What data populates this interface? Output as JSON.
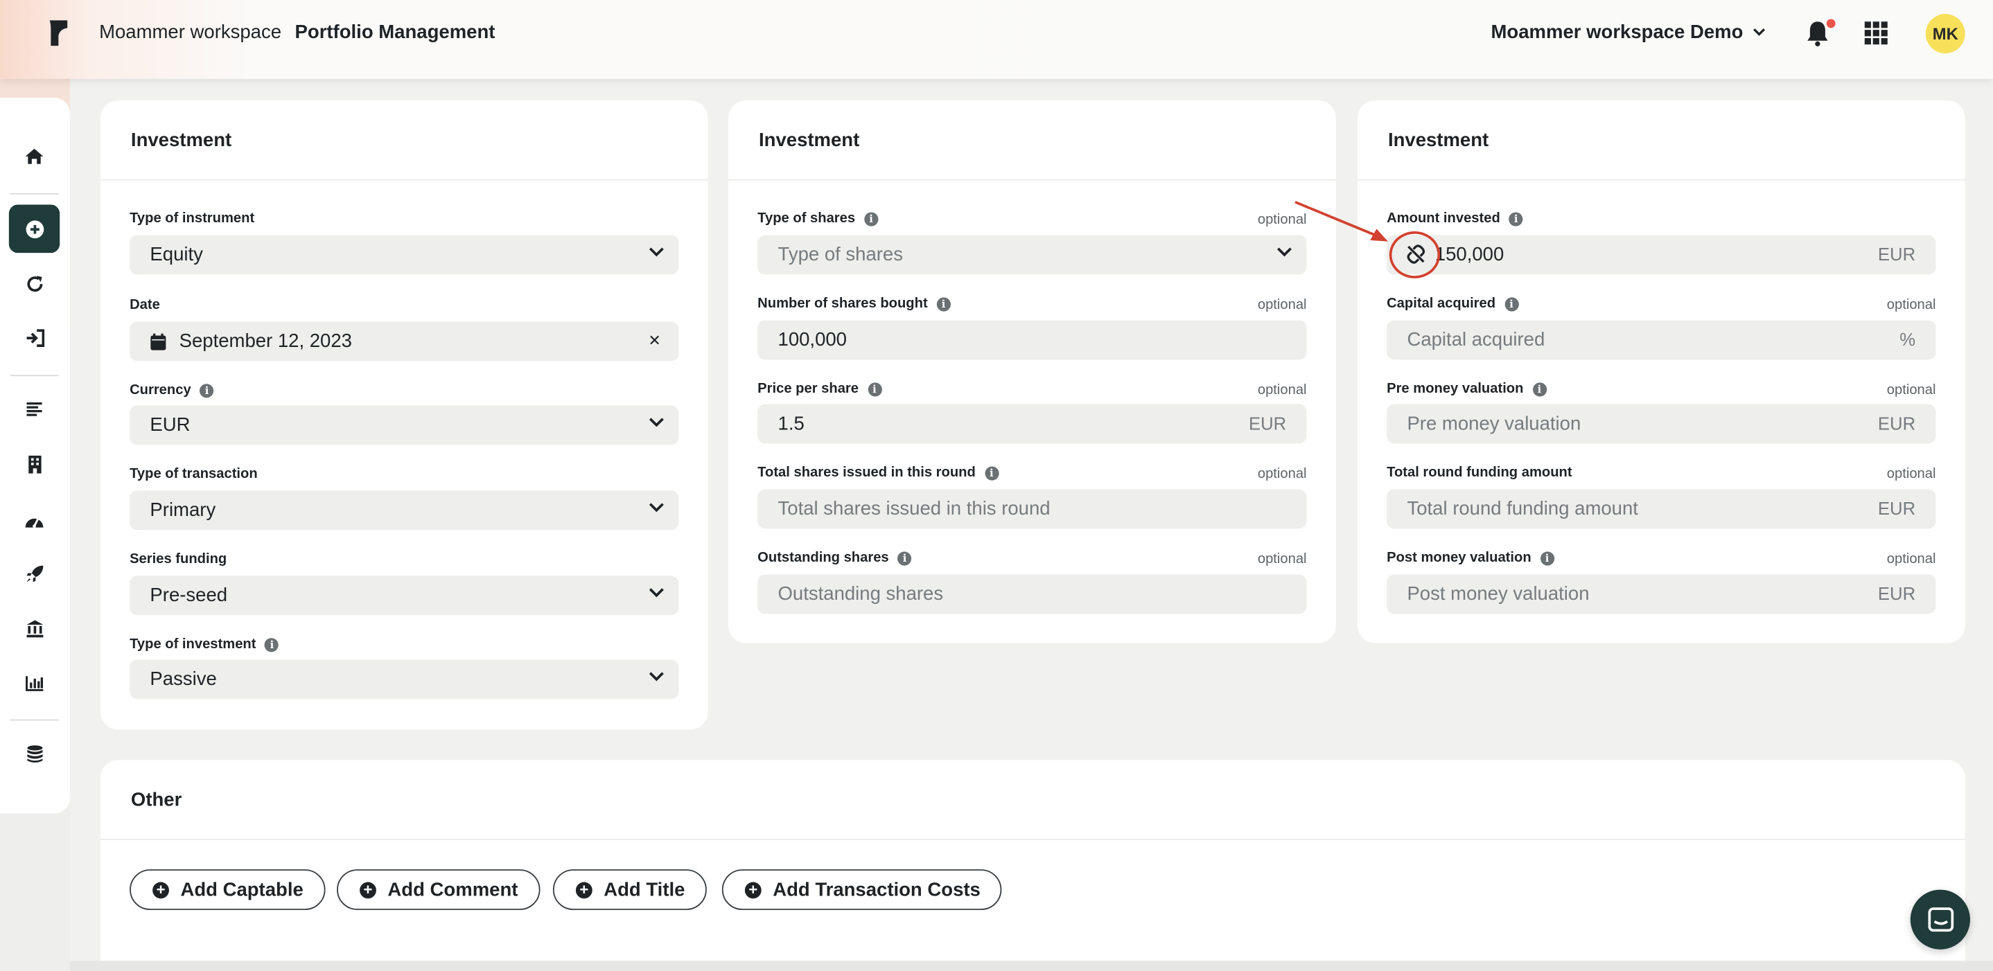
{
  "header": {
    "workspace": "Moammer workspace",
    "page": "Portfolio Management",
    "workspace_select": "Moammer workspace Demo",
    "avatar_initials": "MK"
  },
  "sidebar": {
    "items": [
      "home-icon",
      "plus-circle-icon",
      "refresh-icon",
      "sign-in-icon",
      "list-icon",
      "building-icon",
      "gauge-icon",
      "rocket-icon",
      "bank-icon",
      "chart-icon",
      "database-icon"
    ],
    "active": "plus-circle-icon"
  },
  "card1": {
    "title": "Investment",
    "instrument": {
      "label": "Type of instrument",
      "value": "Equity"
    },
    "date": {
      "label": "Date",
      "value": "September 12, 2023"
    },
    "currency": {
      "label": "Currency",
      "value": "EUR"
    },
    "transaction": {
      "label": "Type of transaction",
      "value": "Primary"
    },
    "series": {
      "label": "Series funding",
      "value": "Pre-seed"
    },
    "investment": {
      "label": "Type of investment",
      "value": "Passive"
    }
  },
  "card2": {
    "title": "Investment",
    "shares_type": {
      "label": "Type of shares",
      "optional": "optional",
      "placeholder": "Type of shares"
    },
    "shares_bought": {
      "label": "Number of shares bought",
      "optional": "optional",
      "value": "100,000"
    },
    "price": {
      "label": "Price per share",
      "optional": "optional",
      "value": "1.5",
      "suffix": "EUR"
    },
    "total_shares": {
      "label": "Total shares issued in this round",
      "optional": "optional",
      "placeholder": "Total shares issued in this round"
    },
    "outstanding": {
      "label": "Outstanding shares",
      "optional": "optional",
      "placeholder": "Outstanding shares"
    }
  },
  "card3": {
    "title": "Investment",
    "amount": {
      "label": "Amount invested",
      "value": "150,000",
      "suffix": "EUR"
    },
    "capital": {
      "label": "Capital acquired",
      "optional": "optional",
      "placeholder": "Capital acquired",
      "suffix": "%"
    },
    "pre_money": {
      "label": "Pre money valuation",
      "optional": "optional",
      "placeholder": "Pre money valuation",
      "suffix": "EUR"
    },
    "total_round": {
      "label": "Total round funding amount",
      "optional": "optional",
      "placeholder": "Total round funding amount",
      "suffix": "EUR"
    },
    "post_money": {
      "label": "Post money valuation",
      "optional": "optional",
      "placeholder": "Post money valuation",
      "suffix": "EUR"
    }
  },
  "other": {
    "title": "Other",
    "buttons": [
      "Add Captable",
      "Add Comment",
      "Add Title",
      "Add Transaction Costs"
    ]
  },
  "colors": {
    "accent": "#1f3b3a",
    "annotation": "#d2412f",
    "avatar": "#f7e05a"
  }
}
